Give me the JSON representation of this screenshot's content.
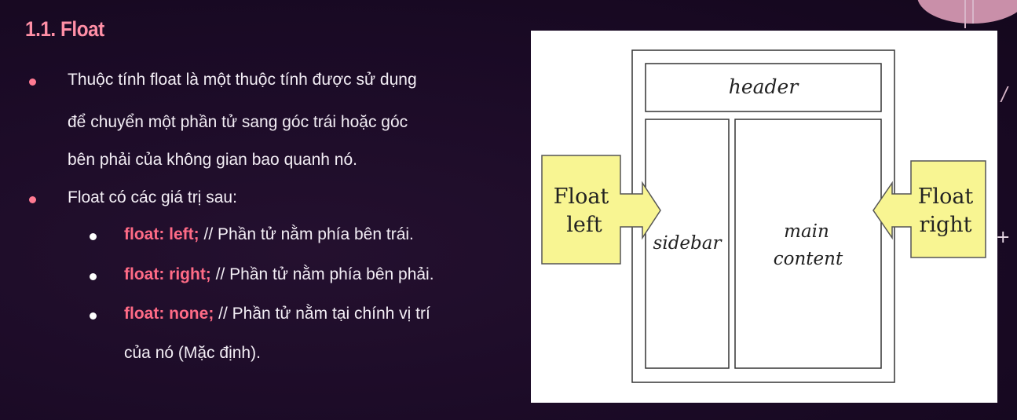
{
  "slide": {
    "title": "1.1. Float",
    "bullets": [
      {
        "lines": [
          "Thuộc tính float là một thuộc tính được sử dụng",
          "để chuyển một phần tử sang góc trái hoặc góc",
          "bên phải của không gian bao quanh nó."
        ]
      },
      {
        "lines": [
          "Float có các giá trị sau:"
        ],
        "sub": [
          {
            "keyword": "float: left;",
            "text": " // Phần tử nằm phía bên trái."
          },
          {
            "keyword": "float: right;",
            "text": " // Phần tử nằm phía bên phải."
          },
          {
            "keyword": "float: none;",
            "text": " // Phần tử nằm tại chính vị trí",
            "cont": "của nó (Mặc định)."
          }
        ]
      }
    ]
  },
  "diagram": {
    "header": "header",
    "sidebar": "sidebar",
    "main_line1": "main",
    "main_line2": "content",
    "float_left_line1": "Float",
    "float_left_line2": "left",
    "float_right_line1": "Float",
    "float_right_line2": "right"
  },
  "colors": {
    "title": "#ff8fa6",
    "bullet_primary": "#ff7a92",
    "keyword": "#ff6b86",
    "callout_fill": "#f8f592"
  }
}
